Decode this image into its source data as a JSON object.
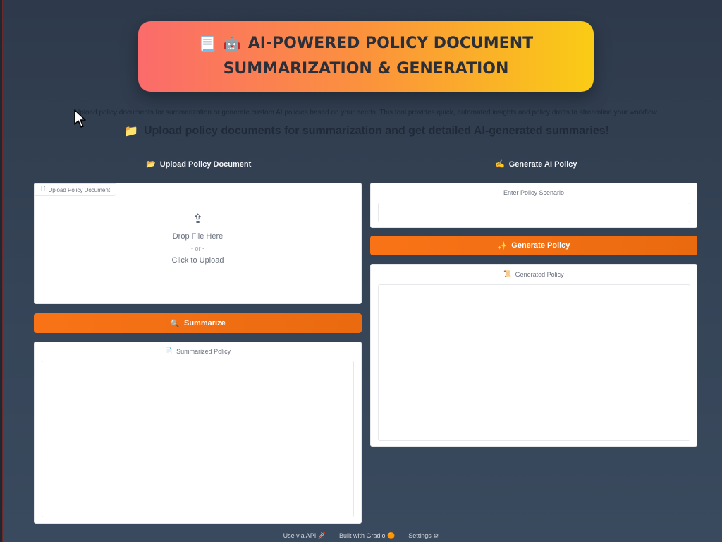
{
  "banner": {
    "icon_doc": "📃",
    "icon_robot": "🤖",
    "line1": "AI-POWERED POLICY DOCUMENT",
    "line2": "SUMMARIZATION & GENERATION"
  },
  "subtitle": "Upload policy documents for summarization or generate custom AI policies based on your needs. This tool provides quick, automated insights and policy drafts to streamline your workflow.",
  "tagline": {
    "icon": "📁",
    "text": "Upload policy documents for summarization and get detailed AI-generated summaries!"
  },
  "left": {
    "title_icon": "📂",
    "title": "Upload Policy Document",
    "upload": {
      "tag_icon": "🗋",
      "tag": "Upload Policy Document",
      "icon": "⇪",
      "drop": "Drop File Here",
      "or": "- or -",
      "click": "Click to Upload"
    },
    "summarize_icon": "🔍",
    "summarize_label": "Summarize",
    "output_icon": "📄",
    "output_label": "Summarized Policy"
  },
  "right": {
    "title_icon": "✍",
    "title": "Generate AI Policy",
    "scenario_label": "Enter Policy Scenario",
    "scenario_placeholder": "",
    "generate_icon": "✨",
    "generate_label": "Generate Policy",
    "output_icon": "📜",
    "output_label": "Generated Policy"
  },
  "footer": {
    "api": "Use via API",
    "api_icon": "🚀",
    "built": "Built with Gradio",
    "built_icon": "🟠",
    "settings": "Settings",
    "settings_icon": "⚙",
    "sep": "·"
  },
  "colors": {
    "accent": "#f97316",
    "banner_start": "#fb6b6b",
    "banner_end": "#facc15",
    "background": "#334155"
  }
}
